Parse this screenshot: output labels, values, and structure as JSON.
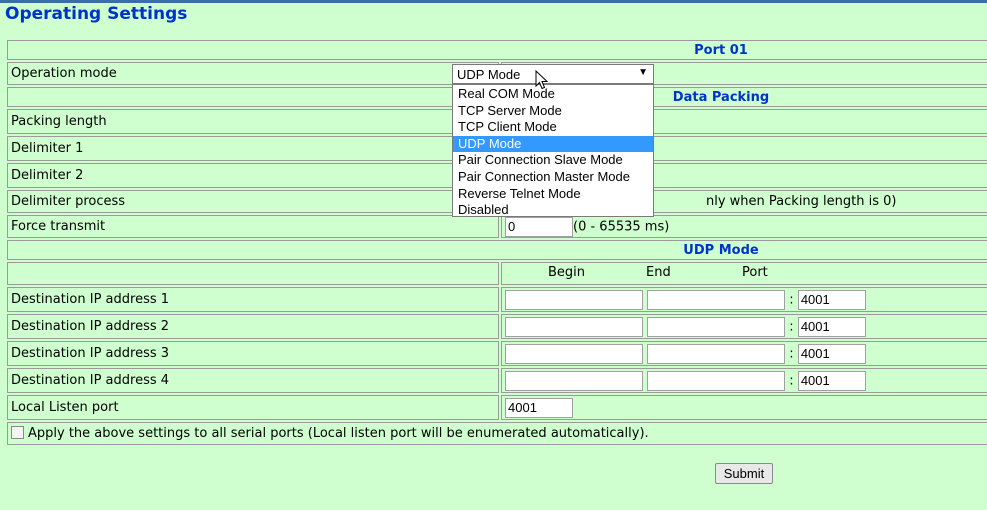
{
  "page": {
    "title": "Operating Settings"
  },
  "port_header": "Port 01",
  "operation_mode": {
    "label": "Operation mode",
    "selected": "UDP Mode",
    "options": [
      "Real COM Mode",
      "TCP Server Mode",
      "TCP Client Mode",
      "UDP Mode",
      "Pair Connection Slave Mode",
      "Pair Connection Master Mode",
      "Reverse Telnet Mode",
      "Disabled"
    ]
  },
  "data_packing": {
    "header": "Data Packing",
    "packing_length": "Packing length",
    "delimiter1": "Delimiter 1",
    "delimiter2": "Delimiter 2",
    "delimiter_process": "Delimiter process",
    "delimiter_note": "nly when Packing length is 0)",
    "force_transmit": "Force transmit",
    "force_transmit_value": "0",
    "force_transmit_range": "(0 - 65535 ms)"
  },
  "udp_mode": {
    "header": "UDP Mode",
    "col_begin": "Begin",
    "col_end": "End",
    "col_port": "Port",
    "destinations": [
      {
        "label": "Destination IP address 1",
        "begin": "",
        "end": "",
        "port": "4001"
      },
      {
        "label": "Destination IP address 2",
        "begin": "",
        "end": "",
        "port": "4001"
      },
      {
        "label": "Destination IP address 3",
        "begin": "",
        "end": "",
        "port": "4001"
      },
      {
        "label": "Destination IP address 4",
        "begin": "",
        "end": "",
        "port": "4001"
      }
    ],
    "port_sep": ":",
    "local_listen_label": "Local Listen port",
    "local_listen_value": "4001"
  },
  "apply_all_label": "Apply the above settings to all serial ports (Local listen port will be enumerated automatically).",
  "submit_label": "Submit"
}
